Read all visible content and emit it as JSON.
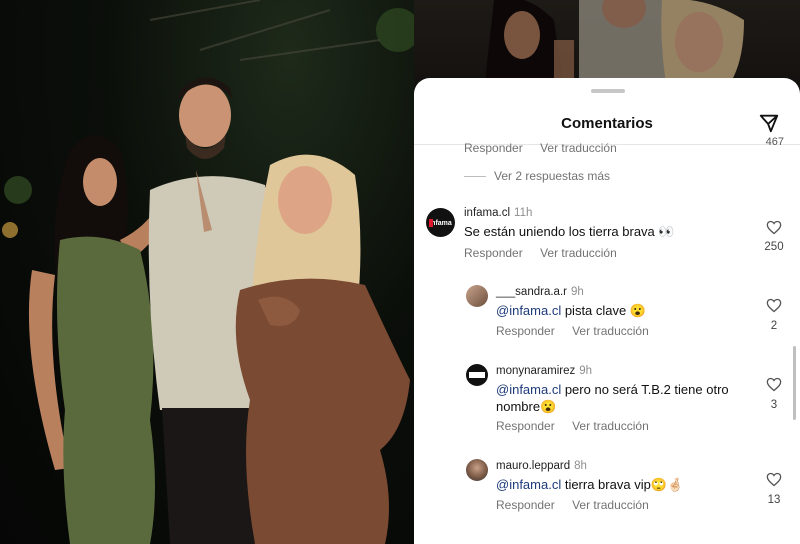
{
  "sheet": {
    "title": "Comentarios",
    "send_icon": "paper-plane-icon",
    "partial": {
      "reply": "Responder",
      "translate": "Ver traducción",
      "count": "467"
    },
    "more_replies": "Ver 2 respuestas más"
  },
  "comments": [
    {
      "username": "infama.cl",
      "time": "11h",
      "text": "Se están uniendo los tierra brava 👀",
      "reply": "Responder",
      "translate": "Ver traducción",
      "likes": "250"
    },
    {
      "username": "___sandra.a.r",
      "time": "9h",
      "mention": "@infama.cl",
      "text": " pista clave 😮",
      "reply": "Responder",
      "translate": "Ver traducción",
      "likes": "2"
    },
    {
      "username": "monynaramirez",
      "time": "9h",
      "mention": "@infama.cl",
      "text": " pero no será T.B.2 tiene otro nombre😮",
      "reply": "Responder",
      "translate": "Ver traducción",
      "likes": "3"
    },
    {
      "username": "mauro.leppard",
      "time": "8h",
      "mention": "@infama.cl",
      "text": " tierra brava vip🙄🤞🏻",
      "reply": "Responder",
      "translate": "Ver traducción",
      "likes": "13"
    }
  ],
  "avatar_logo_text": "infama",
  "colors": {
    "mention": "#1e3a7a",
    "secondary_text": "#737373",
    "sheet_bg": "#ffffff"
  }
}
